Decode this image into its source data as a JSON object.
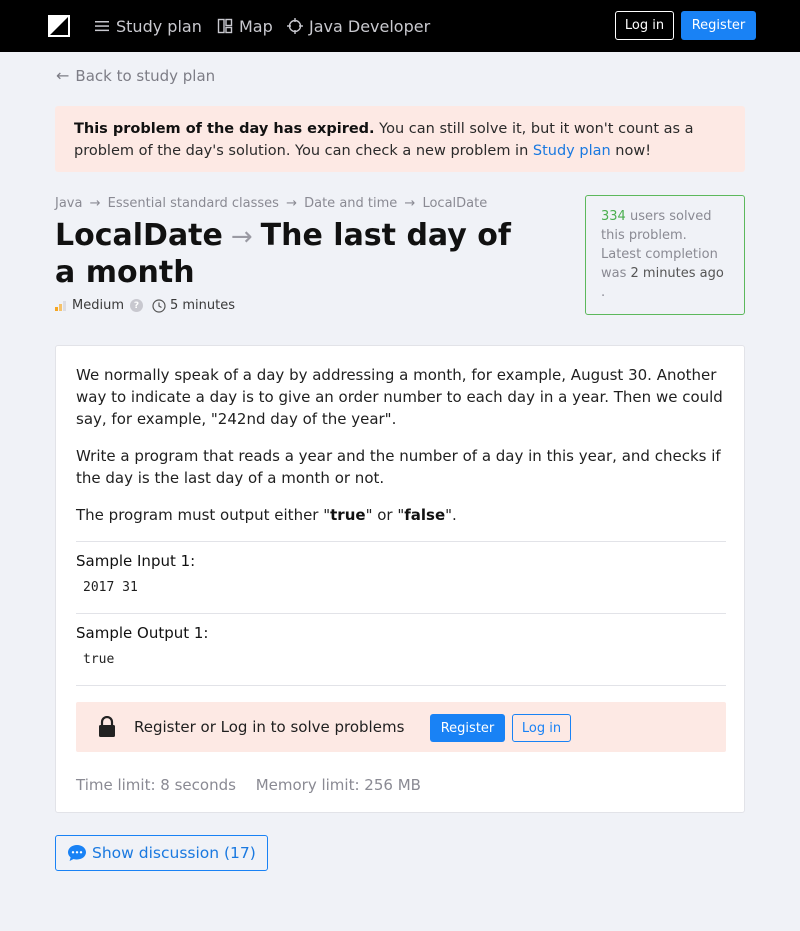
{
  "nav": {
    "study_plan": "Study plan",
    "map": "Map",
    "track": "Java Developer",
    "login": "Log in",
    "register": "Register"
  },
  "back": "Back to study plan",
  "alert": {
    "bold": "This problem of the day has expired.",
    "text": " You can still solve it, but it won't count as a problem of the day's solution. You can check a new problem in ",
    "link": "Study plan",
    "tail": " now!"
  },
  "breadcrumbs": [
    "Java",
    "Essential standard classes",
    "Date and time",
    "LocalDate"
  ],
  "breadcrumb_separator": "→",
  "title": {
    "topic": "LocalDate",
    "arrow": "→",
    "name": "The last day of a month"
  },
  "meta": {
    "difficulty": "Medium",
    "help": "?",
    "duration": "5 minutes"
  },
  "stats": {
    "count": "334",
    "solved_text": " users solved this problem. Latest completion was ",
    "latest": "2 minutes ago",
    "tail": "."
  },
  "problem": {
    "p1": "We normally speak of a day by addressing a month, for example, August 30. Another way to indicate a day is to give an order number to each day in a year. Then we could say, for example, \"242nd day of the year\".",
    "p2": "Write a program that reads a year and the number of a day in this year, and checks if the day is the last day of a month or not.",
    "p3_a": "The program must output either \"",
    "p3_true": "true",
    "p3_b": "\" or \"",
    "p3_false": "false",
    "p3_c": "\"."
  },
  "samples": [
    {
      "label": "Sample Input 1:",
      "value": "2017 31"
    },
    {
      "label": "Sample Output 1:",
      "value": "true"
    }
  ],
  "solve": {
    "text": "Register or Log in to solve problems",
    "register": "Register",
    "login": "Log in"
  },
  "limits": {
    "time": "Time limit: 8 seconds",
    "memory": "Memory limit: 256 MB"
  },
  "discussion": "Show discussion (17)",
  "colors": {
    "accent": "#1982f5",
    "alert_bg": "#fde9e4",
    "success": "#5cb85c",
    "difficulty_bars": [
      "#f5a623",
      "#f5c26b",
      "#dcdce2"
    ]
  }
}
